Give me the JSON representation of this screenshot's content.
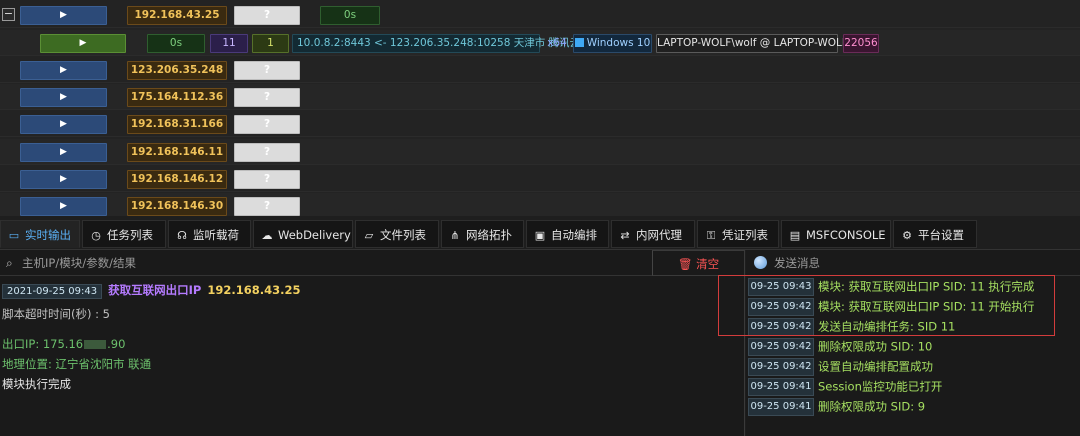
{
  "hosts": {
    "expander_symbol": "−",
    "play_symbol": "▶",
    "rows": [
      {
        "ip": "192.168.43.25",
        "status": "?",
        "elapsed": "0s"
      },
      {
        "ip": "123.206.35.248",
        "status": "?"
      },
      {
        "ip": "175.164.112.36",
        "status": "?"
      },
      {
        "ip": "192.168.31.166",
        "status": "?"
      },
      {
        "ip": "192.168.146.11",
        "status": "?"
      },
      {
        "ip": "192.168.146.12",
        "status": "?"
      },
      {
        "ip": "192.168.146.30",
        "status": "?"
      }
    ],
    "session": {
      "elapsed": "0s",
      "sid": "11",
      "count": "1",
      "connection": "10.0.8.2:8443 <- 123.206.35.248:10258 天津市 腾讯云",
      "arch": "x64",
      "os": "Windows 10",
      "user": "LAPTOP-WOLF\\wolf @ LAPTOP-WOLF",
      "pid": "22056"
    }
  },
  "tabs": [
    {
      "label": "实时输出",
      "icon": "monitor-icon"
    },
    {
      "label": "任务列表",
      "icon": "clock-icon"
    },
    {
      "label": "监听载荷",
      "icon": "headset-icon"
    },
    {
      "label": "WebDelivery",
      "icon": "cloud-icon"
    },
    {
      "label": "文件列表",
      "icon": "folder-icon"
    },
    {
      "label": "网络拓扑",
      "icon": "network-icon"
    },
    {
      "label": "自动编排",
      "icon": "robot-icon"
    },
    {
      "label": "内网代理",
      "icon": "proxy-icon"
    },
    {
      "label": "凭证列表",
      "icon": "key-icon"
    },
    {
      "label": "MSFCONSOLE",
      "icon": "terminal-icon"
    },
    {
      "label": "平台设置",
      "icon": "gear-icon"
    }
  ],
  "search": {
    "placeholder": "主机IP/模块/参数/结果",
    "clear_label": "清空"
  },
  "message": {
    "placeholder": "发送消息"
  },
  "output": {
    "timestamp": "2021-09-25 09:43",
    "module_name": "获取互联网出口IP",
    "module_ip": "192.168.43.25",
    "timeout_label": "脚本超时时间(秒) : 5",
    "exit_ip_prefix": "出口IP: 175.16",
    "exit_ip_suffix": ".90",
    "location": "地理位置: 辽宁省沈阳市 联通",
    "done": "模块执行完成"
  },
  "log": [
    {
      "time": "09-25 09:43",
      "text": "模块: 获取互联网出口IP SID: 11 执行完成"
    },
    {
      "time": "09-25 09:42",
      "text": "模块: 获取互联网出口IP SID: 11 开始执行"
    },
    {
      "time": "09-25 09:42",
      "text": "发送自动编排任务: SID 11"
    },
    {
      "time": "09-25 09:42",
      "text": "删除权限成功 SID: 10"
    },
    {
      "time": "09-25 09:42",
      "text": "设置自动编排配置成功"
    },
    {
      "time": "09-25 09:41",
      "text": "Session监控功能已打开"
    },
    {
      "time": "09-25 09:41",
      "text": "删除权限成功 SID: 9"
    }
  ],
  "colors": {
    "accent": "#5ab0f5",
    "danger": "#ff5555",
    "log_text": "#a6e061",
    "ip_text": "#f0c25a"
  }
}
